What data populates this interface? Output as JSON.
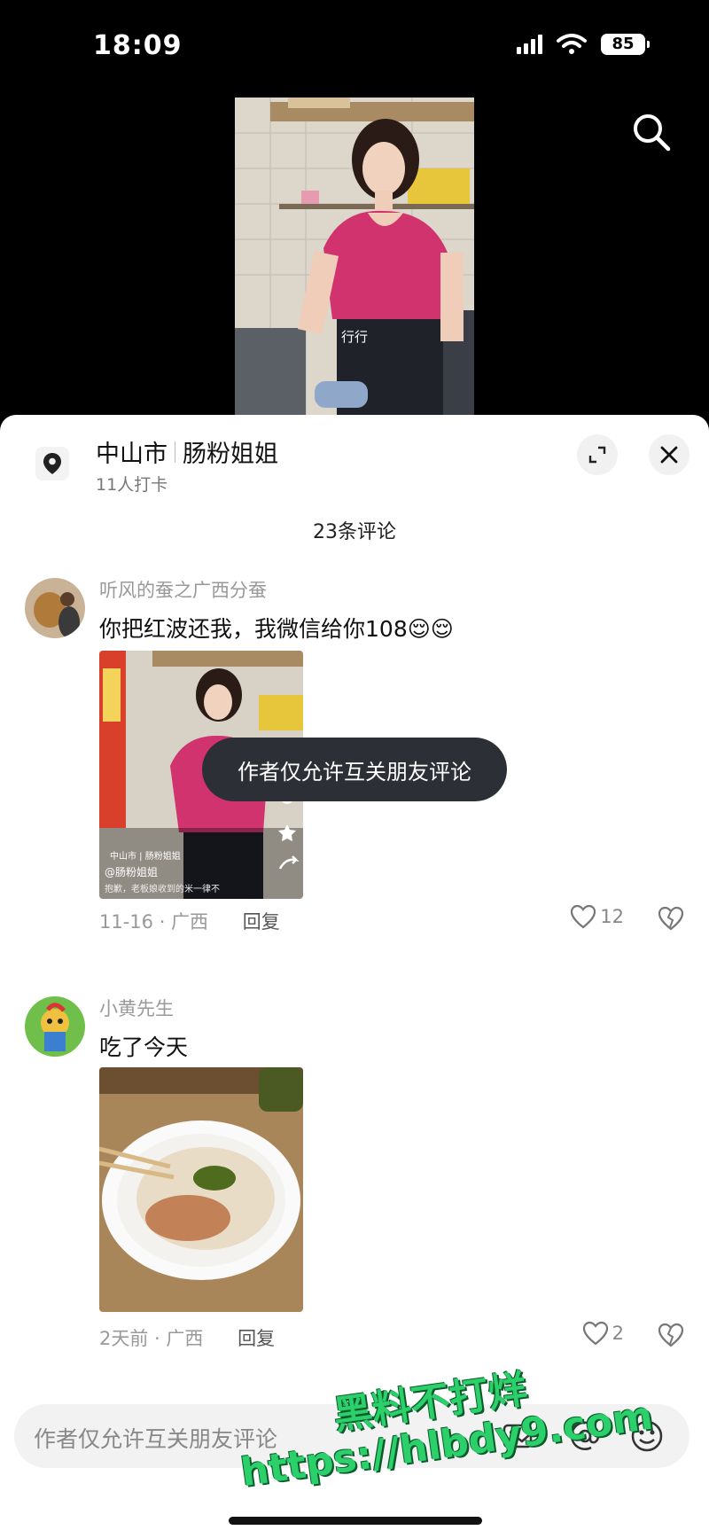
{
  "status_bar": {
    "time": "18:09",
    "battery": "85"
  },
  "video": {
    "caption": "行行"
  },
  "location": {
    "city": "中山市",
    "place": "肠粉姐姐",
    "checkins": "11人打卡"
  },
  "comments_header": "23条评论",
  "comments": [
    {
      "user": "听风的蚕之广西分蚕",
      "text": "你把红波还我，我微信给你108😌😌",
      "date": "11-16 · 广西",
      "reply": "回复",
      "likes": "12",
      "image_overlay": {
        "location": "中山市 | 肠粉姐姐",
        "author": "@肠粉姐姐",
        "desc": "抱歉，老板娘收到的米一律不"
      }
    },
    {
      "user": "小黄先生",
      "text": "吃了今天",
      "date": "2天前 · 广西",
      "reply": "回复",
      "likes": "2"
    }
  ],
  "toast": "作者仅允许互关朋友评论",
  "input": {
    "placeholder": "作者仅允许互关朋友评论"
  },
  "watermark": {
    "line1": "黑料不打烊",
    "line2": "https://hlbdy9.com"
  },
  "icons": [
    "search-icon",
    "location-pin-icon",
    "expand-icon",
    "close-icon",
    "heart-icon",
    "dislike-heart-icon",
    "image-icon",
    "at-icon",
    "emoji-icon"
  ]
}
